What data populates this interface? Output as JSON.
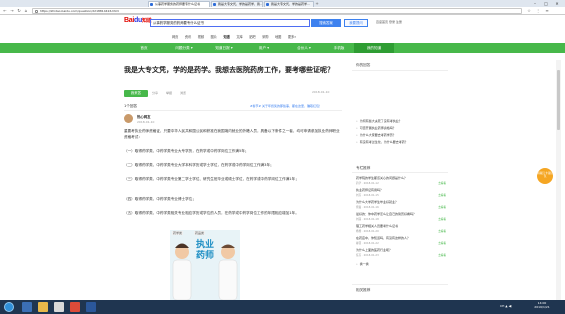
{
  "browser": {
    "tabs": [
      {
        "label": "从事药学服务的药师要专什么证书"
      },
      {
        "label": "我是大专文凭，学的是药学，我..."
      },
      {
        "label": "我是大专文凭，学的是药学..."
      }
    ],
    "url": "https://zhidao.baidu.com/question/2218814416.html"
  },
  "header": {
    "logo_bai": "Bai",
    "logo_du": "du",
    "logo_zd": "知道",
    "search_value": "从事药学服务的药师要专什么证书",
    "search_button": "搜索答案",
    "ask_button": "我要提问",
    "top_links": "百度首页  登录  注册",
    "subnav": [
      "网页",
      "资讯",
      "视频",
      "图片",
      "知道",
      "文库",
      "贴吧",
      "采购",
      "地图",
      "更多»"
    ],
    "subnav_current": 4
  },
  "green_nav": [
    "首页",
    "问题分类 ▾",
    "知道日报 ▾",
    "用户 ▾",
    "合伙人 ▾",
    "手机版",
    "我的知道"
  ],
  "green_nav_current": 6,
  "question": {
    "title": "我是大专文凭，学的是药学。我想去医院药房工作，要考哪些证呢？",
    "date": "2018-01-10",
    "answer_button": "我来答",
    "meta": [
      "分享",
      "举报",
      "浏览"
    ]
  },
  "answers": {
    "count": "1个回答",
    "prompt": "#春节#   关于年终奖的那些事，都在这里，赚取红包！"
  },
  "answer": {
    "user": "热心网友",
    "date": "2018-01-10",
    "paragraphs": [
      "重要考执业药师资格证，只要中华人民共和国公民和获准在我国境内就业的外籍人员，具备以下条件之一者，均可申请参加执业药师职业资格考试：",
      "（一）取得药学类、中药学类专业大专学历，在药学或中药学岗位工作满5年；",
      "（二）取得药学类、中药学类专业大学本科学历或学士学位，在药学或中药学岗位工作满3年；",
      "（三）取得药学类、中药学类专业第二学士学位、研究生班毕业或硕士学位，在药学或中药学岗位工作满1年；",
      "（四）取得药学类、中药学类专业博士学位；",
      "（五）取得药学类、中药学类相关专业相应学历或学位的人员，在药学或中药学岗位工作的年限相应增加1年。"
    ],
    "image_tags": [
      "药学类",
      "药品类"
    ],
    "image_text": "执业药师"
  },
  "sidebar": {
    "head1": "你的回答",
    "related_head": "相关问题",
    "related": [
      "为何有些大夫死了没有考执业？",
      "可否开展执业药师资格吗？",
      "为什么大家要去考药学历？",
      "有没有考过生化，为什么要去考药？"
    ],
    "rec_head": "专栏推荐",
    "recs": [
      {
        "title": "药学院的学生都该关心的问题是什么？",
        "meta": "药学 · 2018-01-12",
        "action": "去看看"
      },
      {
        "title": "执业药师证有用吗？",
        "meta": "刘苏 · 2018-01-15",
        "action": "去看看"
      },
      {
        "title": "为什么大学药学生毕业好就业？",
        "meta": "熊猫 · 2018-01-16",
        "action": "去看看"
      },
      {
        "title": "最好的：你中药学怎么让自己的简历好看吗？",
        "meta": "刘丽 · 2018-01-18",
        "action": "去看看"
      },
      {
        "title": "理工药学相关人员要考什么证书",
        "meta": "杨杨 · 2018-01-20",
        "action": "去看看"
      },
      {
        "title": "在药店中，你知道吗，有没有这样的人？",
        "meta": "柳亚 · 2018-01-22",
        "action": "去看看"
      },
      {
        "title": "为什么上面的医药行业呢？",
        "meta": "任苏 · 2018-01-23",
        "action": "去看看"
      }
    ],
    "more": "换一换",
    "bottom_head": "相关推荐"
  },
  "float_badge": "捐献打卡领红包",
  "taskbar": {
    "time": "14:00",
    "date": "2019/1/21",
    "tray": "CH ▲ ◀)"
  }
}
